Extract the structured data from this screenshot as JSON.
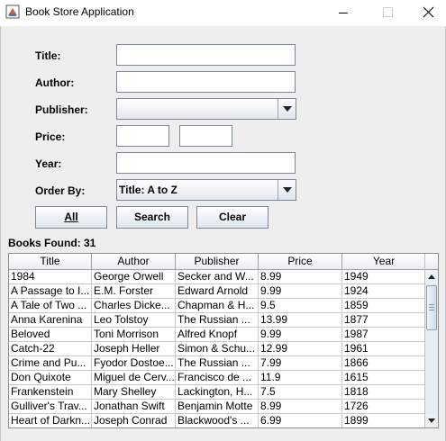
{
  "window": {
    "title": "Book Store Application",
    "icon": "java-app-icon"
  },
  "form": {
    "title_label": "Title:",
    "title_value": "",
    "author_label": "Author:",
    "author_value": "",
    "publisher_label": "Publisher:",
    "publisher_selected": "",
    "price_label": "Price:",
    "price_min_value": "",
    "price_max_value": "",
    "year_label": "Year:",
    "year_value": "",
    "orderby_label": "Order By:",
    "orderby_selected": "Title: A to Z"
  },
  "buttons": {
    "all": "All",
    "search": "Search",
    "clear": "Clear"
  },
  "results": {
    "found_text": "Books Found: 31"
  },
  "table": {
    "columns": [
      "Title",
      "Author",
      "Publisher",
      "Price",
      "Year"
    ],
    "rows": [
      [
        "1984",
        "George Orwell",
        "Secker and W...",
        "8.99",
        "1949"
      ],
      [
        "A Passage to I...",
        "E.M. Forster",
        "Edward Arnold",
        "9.99",
        "1924"
      ],
      [
        "A Tale of Two ...",
        "Charles Dicke...",
        "Chapman & H...",
        "9.5",
        "1859"
      ],
      [
        "Anna Karenina",
        "Leo Tolstoy",
        "The Russian ...",
        "13.99",
        "1877"
      ],
      [
        "Beloved",
        "Toni Morrison",
        "Alfred Knopf",
        "9.99",
        "1987"
      ],
      [
        "Catch-22",
        "Joseph Heller",
        "Simon & Schu...",
        "12.99",
        "1961"
      ],
      [
        "Crime and Pu...",
        "Fyodor Dostoe...",
        "The Russian ...",
        "7.99",
        "1866"
      ],
      [
        "Don Quixote",
        "Miguel de Cerv...",
        "Francisco de ...",
        "11.9",
        "1615"
      ],
      [
        "Frankenstein",
        "Mary Shelley",
        "Lackington, H...",
        "7.5",
        "1818"
      ],
      [
        "Gulliver's Trav...",
        "Jonathan Swift",
        "Benjamin Motte",
        "8.99",
        "1726"
      ],
      [
        "Heart of Darkn...",
        "Joseph Conrad",
        "Blackwood's ...",
        "6.99",
        "1899"
      ]
    ]
  },
  "colors": {
    "window_bg": "#eeeeee",
    "field_border": "#7a8a99",
    "button_gradient_bottom": "#dde6ee"
  }
}
